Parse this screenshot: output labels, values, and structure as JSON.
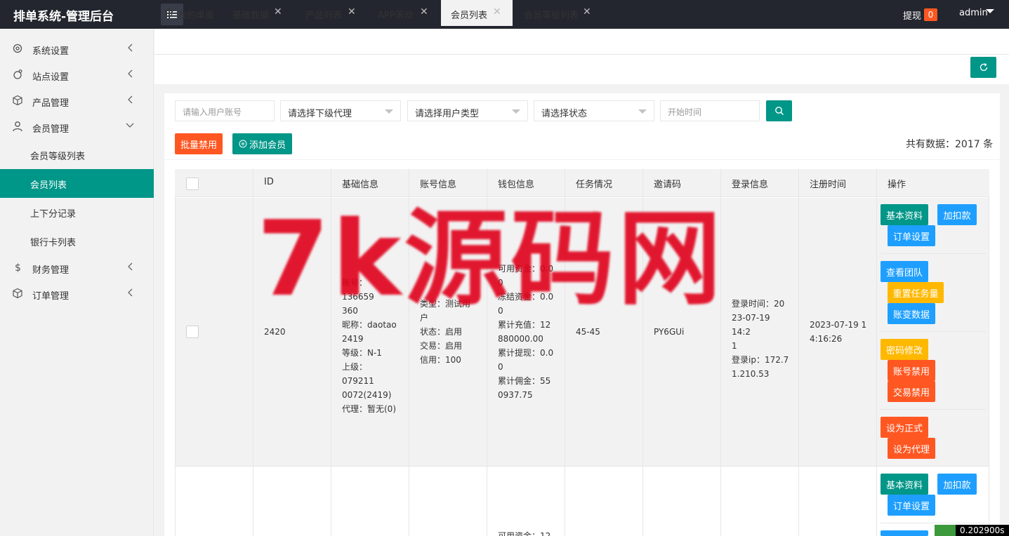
{
  "header": {
    "title": "排单系统-管理后台",
    "withdraw_label": "提现",
    "withdraw_count": "0",
    "user": "admin"
  },
  "sidebar": {
    "items": [
      {
        "label": "系统设置",
        "icon": "gear-icon"
      },
      {
        "label": "站点设置",
        "icon": "site-icon"
      },
      {
        "label": "产品管理",
        "icon": "box-icon"
      },
      {
        "label": "会员管理",
        "icon": "user-icon"
      },
      {
        "label": "财务管理",
        "icon": "dollar-icon"
      },
      {
        "label": "订单管理",
        "icon": "box-icon"
      }
    ],
    "subitems": [
      {
        "label": "会员等级列表"
      },
      {
        "label": "会员列表"
      },
      {
        "label": "上下分记录"
      },
      {
        "label": "银行卡列表"
      }
    ]
  },
  "tabs": [
    {
      "label": "我的桌面"
    },
    {
      "label": "基础数据"
    },
    {
      "label": "产品列表"
    },
    {
      "label": "APP滚动"
    },
    {
      "label": "会员列表"
    },
    {
      "label": "会员等级列表"
    }
  ],
  "filters": {
    "account_placeholder": "请输入用户账号",
    "agent_select": "请选择下级代理",
    "type_select": "请选择用户类型",
    "status_select": "请选择状态",
    "start_time_placeholder": "开始时间"
  },
  "actions": {
    "batch_disable": "批量禁用",
    "add_member": "添加会员",
    "total": "共有数据：2017 条"
  },
  "table": {
    "headers": [
      "ID",
      "基础信息",
      "账号信息",
      "钱包信息",
      "任务情况",
      "邀请码",
      "登录信息",
      "注册时间",
      "操作"
    ],
    "row1": {
      "id": "2420",
      "basic": [
        "账号：136659",
        "360",
        "昵称：daotao",
        "2419",
        "等级：N-1",
        "上级：079211",
        "0072(2419)",
        "代理：暂无(0)"
      ],
      "account": [
        "类型：测试用",
        "户",
        "状态：启用",
        "交易：启用",
        "信用：100"
      ],
      "wallet": [
        "可用资金：0.0",
        "0",
        "冻结资金：0.0",
        "0",
        "累计充值：12",
        "880000.00",
        "累计提现：0.0",
        "0",
        "累计佣金：55",
        "0937.75"
      ],
      "task": "45-45",
      "invite": "PY6GUi",
      "login": [
        "登录时间：20",
        "23-07-19 14:2",
        "1",
        "登录ip：172.7",
        "1.210.53"
      ],
      "register": [
        "2023-07-19 1",
        "4:16:26"
      ]
    },
    "row2": {
      "wallet_partial": "可用资金：12"
    },
    "ops": {
      "basic_info": "基本资料",
      "add_deduct": "加扣款",
      "order_settings": "订单设置",
      "view_team": "查看团队",
      "reset_task": "重置任务量",
      "account_change": "账变数据",
      "password_change": "密码修改",
      "account_disable": "账号禁用",
      "trade_disable": "交易禁用",
      "set_formal": "设为正式",
      "set_agent": "设为代理"
    }
  },
  "watermark": "7k源码网",
  "footer": {
    "timer": "0.202900s"
  },
  "colors": {
    "header_bg": "#23262e",
    "primary": "#009688",
    "danger": "#ff5722",
    "info": "#1e9fff",
    "warning": "#ffb800"
  }
}
